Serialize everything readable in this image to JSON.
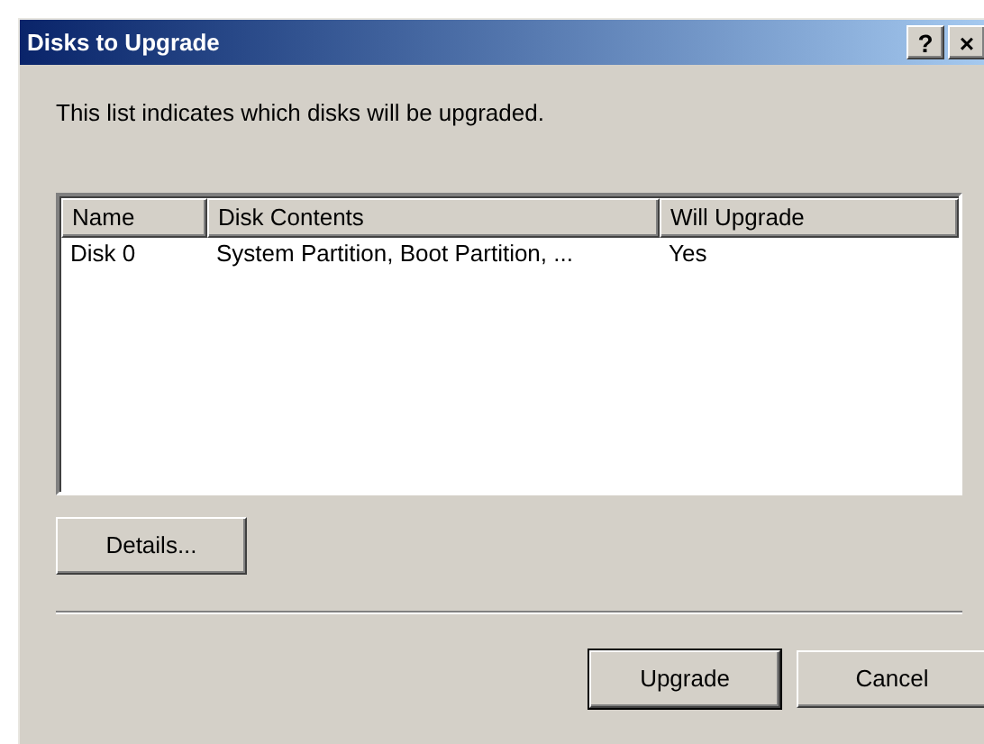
{
  "window": {
    "title": "Disks to Upgrade",
    "title_buttons": [
      "?",
      "×"
    ]
  },
  "description": "This list indicates which disks will be upgraded.",
  "table": {
    "columns": [
      "Name",
      "Disk Contents",
      "Will Upgrade"
    ],
    "rows": [
      [
        "Disk 0",
        "System Partition, Boot Partition, ...",
        "Yes"
      ]
    ]
  },
  "details_button": "Details...",
  "buttons": [
    {
      "label": "Upgrade",
      "default": true
    },
    {
      "label": "Cancel",
      "default": false
    }
  ]
}
